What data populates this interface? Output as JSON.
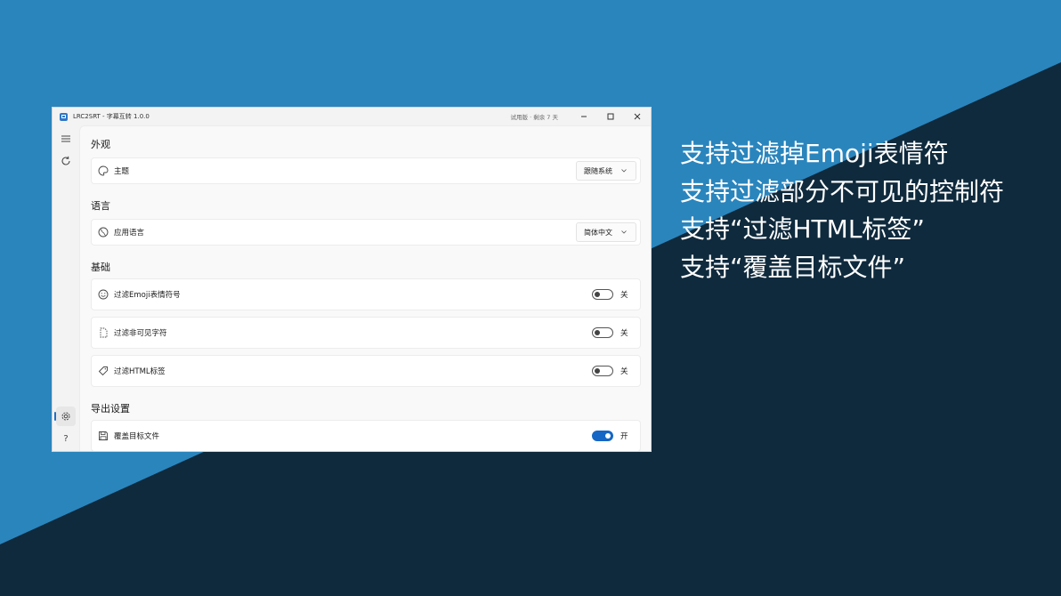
{
  "colors": {
    "bg_blue": "#2a85bd",
    "bg_dark": "#0f2a3d",
    "accent": "#1666c5"
  },
  "window": {
    "title": "LRC2SRT - 字幕互转 1.0.0",
    "trial": "试用版 · 剩余 7 天",
    "controls": [
      "minimize-icon",
      "maximize-icon",
      "close-icon"
    ]
  },
  "sidebar": {
    "items": [
      {
        "name": "menu-icon"
      },
      {
        "name": "refresh-icon"
      },
      {
        "name": "settings-icon"
      },
      {
        "name": "help-icon",
        "glyph": "?"
      }
    ]
  },
  "sections": {
    "appearance": {
      "title": "外观",
      "theme": {
        "label": "主题",
        "value": "跟随系统",
        "icon": "palette-icon"
      }
    },
    "language": {
      "title": "语言",
      "app_language": {
        "label": "应用语言",
        "value": "简体中文",
        "icon": "globe-icon"
      }
    },
    "basic": {
      "title": "基础",
      "items": [
        {
          "label": "过滤Emoji表情符号",
          "state": "关",
          "on": false,
          "icon": "emoji-icon"
        },
        {
          "label": "过滤非可见字符",
          "state": "关",
          "on": false,
          "icon": "dashed-file-icon"
        },
        {
          "label": "过滤HTML标签",
          "state": "关",
          "on": false,
          "icon": "tag-icon"
        }
      ]
    },
    "export": {
      "title": "导出设置",
      "items": [
        {
          "label": "覆盖目标文件",
          "state": "开",
          "on": true,
          "icon": "save-icon"
        }
      ]
    }
  },
  "captions": [
    "支持过滤掉Emoji表情符",
    "支持过滤部分不可见的控制符",
    "支持“过滤HTML标签”",
    "支持“覆盖目标文件”"
  ]
}
